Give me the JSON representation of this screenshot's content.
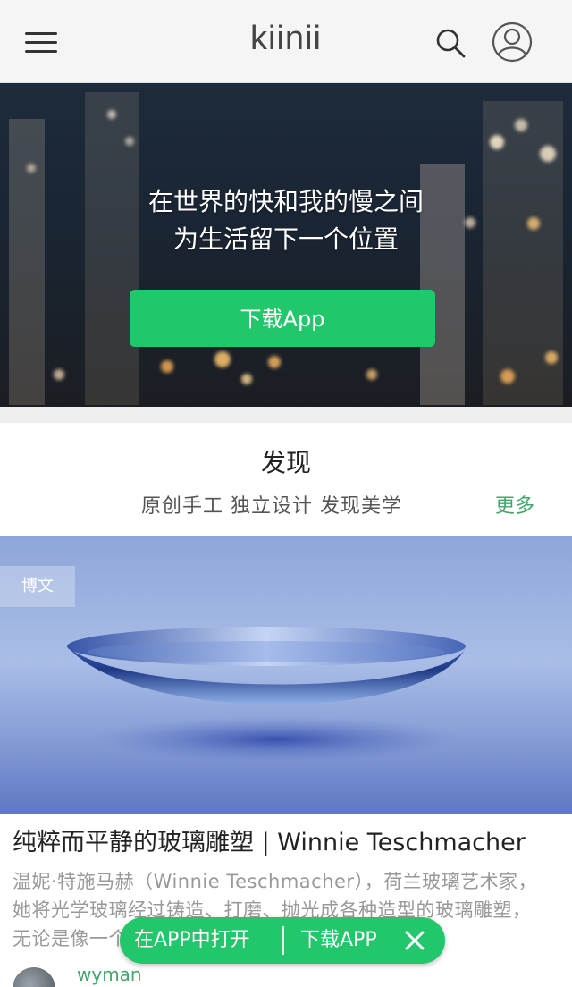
{
  "header": {
    "logo": "kiinii",
    "icons": {
      "menu": "menu-icon",
      "search": "search-icon",
      "account": "user-avatar-icon"
    }
  },
  "hero": {
    "line1": "在世界的快和我的慢之间",
    "line2": "为生活留下一个位置",
    "button_label": "下载App"
  },
  "discover": {
    "title": "发现",
    "subtitle": "原创手工 独立设计 发现美学",
    "more_label": "更多"
  },
  "article": {
    "tag": "博文",
    "title": "纯粹而平静的玻璃雕塑 | Winnie Teschmacher",
    "excerpt": "温妮·特施马赫（Winnie Teschmacher），荷兰玻璃艺术家，她将光学玻璃经过铸造、打磨、抛光成各种造型的玻璃雕塑，无论是像一个圆环，还是像一个几…",
    "author": "wyman"
  },
  "floating_bar": {
    "open_in_app": "在APP中打开",
    "download_app": "下载APP"
  },
  "colors": {
    "accent_green": "#22c66b",
    "link_green": "#43a66a",
    "header_bg": "#f5f5f5"
  }
}
